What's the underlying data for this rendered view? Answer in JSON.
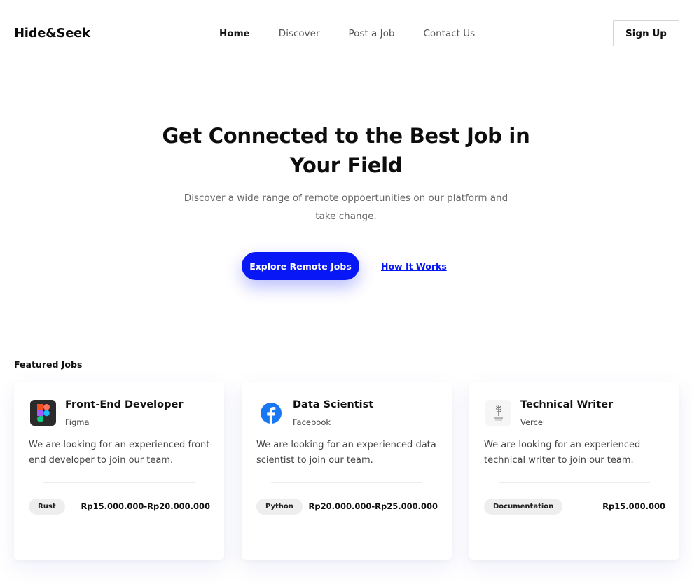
{
  "nav": {
    "brand": "Hide&Seek",
    "links": [
      {
        "label": "Home",
        "active": true
      },
      {
        "label": "Discover",
        "active": false
      },
      {
        "label": "Post a Job",
        "active": false
      },
      {
        "label": "Contact Us",
        "active": false
      }
    ],
    "signup_label": "Sign Up"
  },
  "hero": {
    "title": "Get Connected to the Best Job in Your Field",
    "subtitle": "Discover a wide range of remote oppoertunities on our platform and take change.",
    "primary_cta": "Explore Remote Jobs",
    "secondary_cta": "How It Works"
  },
  "featured": {
    "title": "Featured Jobs",
    "jobs": [
      {
        "title": "Front-End Developer",
        "company": "Figma",
        "logo_icon": "figma-icon",
        "description": "We are looking for an experienced front-end developer to join our team.",
        "tag": "Rust",
        "salary": "Rp15.000.000-Rp20.000.000"
      },
      {
        "title": "Data Scientist",
        "company": "Facebook",
        "logo_icon": "facebook-icon",
        "description": "We are looking for an experienced data scientist to join our team.",
        "tag": "Python",
        "salary": "Rp20.000.000-Rp25.000.000"
      },
      {
        "title": "Technical Writer",
        "company": "Vercel",
        "logo_icon": "vercel-logo-icon",
        "description": "We are looking for an experienced technical writer to join our team.",
        "tag": "Documentation",
        "salary": "Rp15.000.000"
      }
    ]
  },
  "colors": {
    "accent": "#0717f5",
    "facebook_blue": "#1877f2"
  }
}
